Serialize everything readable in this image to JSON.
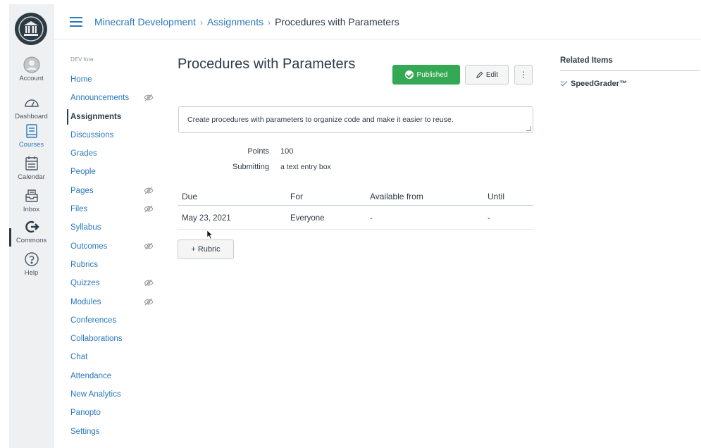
{
  "global_nav": {
    "items": [
      {
        "label": "Account",
        "icon": "account-icon"
      },
      {
        "label": "Dashboard",
        "icon": "dashboard-icon"
      },
      {
        "label": "Courses",
        "icon": "courses-icon"
      },
      {
        "label": "Calendar",
        "icon": "calendar-icon"
      },
      {
        "label": "Inbox",
        "icon": "inbox-icon"
      },
      {
        "label": "Commons",
        "icon": "commons-icon"
      },
      {
        "label": "Help",
        "icon": "help-icon"
      }
    ]
  },
  "breadcrumb": {
    "course": "Minecraft Development",
    "section": "Assignments",
    "current": "Procedures with Parameters"
  },
  "course_nav": {
    "term_label": "DEV fore",
    "items": [
      {
        "label": "Home",
        "hidden": false
      },
      {
        "label": "Announcements",
        "hidden": true
      },
      {
        "label": "Assignments",
        "hidden": false,
        "active": true
      },
      {
        "label": "Discussions",
        "hidden": false
      },
      {
        "label": "Grades",
        "hidden": false
      },
      {
        "label": "People",
        "hidden": false
      },
      {
        "label": "Pages",
        "hidden": true
      },
      {
        "label": "Files",
        "hidden": true
      },
      {
        "label": "Syllabus",
        "hidden": false
      },
      {
        "label": "Outcomes",
        "hidden": true
      },
      {
        "label": "Rubrics",
        "hidden": false
      },
      {
        "label": "Quizzes",
        "hidden": true
      },
      {
        "label": "Modules",
        "hidden": true
      },
      {
        "label": "Conferences",
        "hidden": false
      },
      {
        "label": "Collaborations",
        "hidden": false
      },
      {
        "label": "Chat",
        "hidden": false
      },
      {
        "label": "Attendance",
        "hidden": false
      },
      {
        "label": "New Analytics",
        "hidden": false
      },
      {
        "label": "Panopto",
        "hidden": false
      },
      {
        "label": "Settings",
        "hidden": false
      }
    ]
  },
  "assignment": {
    "title": "Procedures with Parameters",
    "published_label": "Published",
    "edit_label": "Edit",
    "more_label": "⋮",
    "description": "Create procedures with parameters to organize code and make it easier to reuse.",
    "points_label": "Points",
    "points_value": "100",
    "submitting_label": "Submitting",
    "submitting_value": "a text entry box"
  },
  "due_table": {
    "headers": [
      "Due",
      "For",
      "Available from",
      "Until"
    ],
    "rows": [
      [
        "May 23, 2021",
        "Everyone",
        "-",
        "-"
      ]
    ]
  },
  "rubric_button": "+ Rubric",
  "related": {
    "heading": "Related Items",
    "items": [
      "SpeedGrader™"
    ]
  },
  "colors": {
    "link": "#2a78bd",
    "published": "#34a853",
    "text": "#2d3b45"
  }
}
